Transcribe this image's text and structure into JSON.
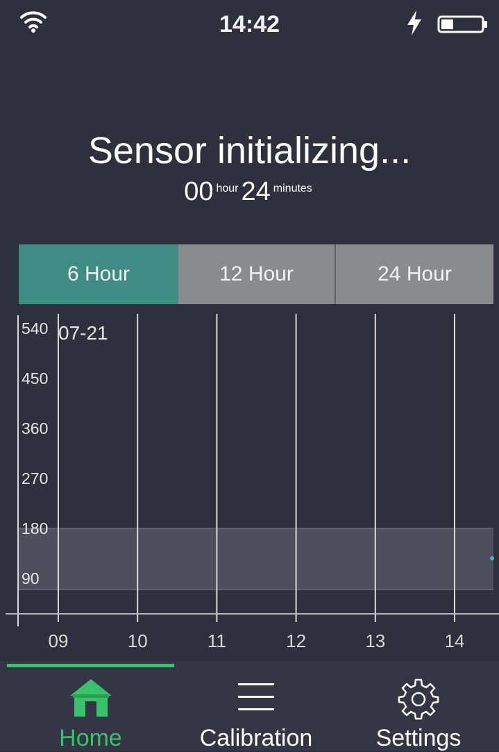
{
  "status_bar": {
    "time": "14:42",
    "wifi_icon": "wifi-icon",
    "charging_icon": "lightning-bolt-icon",
    "battery_icon": "battery-icon",
    "battery_level": 0.3
  },
  "header": {
    "title": "Sensor initializing...",
    "hours_value": "00",
    "hours_unit": "hour",
    "minutes_value": "24",
    "minutes_unit": "minutes"
  },
  "range_tabs": [
    {
      "label": "6 Hour",
      "active": true
    },
    {
      "label": "12 Hour",
      "active": false
    },
    {
      "label": "24 Hour",
      "active": false
    }
  ],
  "chart_data": {
    "type": "line",
    "date_label": "07-21",
    "y_ticks": [
      540,
      450,
      360,
      270,
      180,
      90
    ],
    "x_ticks": [
      "09",
      "10",
      "11",
      "12",
      "13",
      "14"
    ],
    "target_range": [
      70,
      180
    ],
    "ylim": [
      0,
      540
    ],
    "grid": "vertical lines at each hour",
    "series": [
      {
        "values": []
      }
    ],
    "colors": {
      "band": "#4d4f5c",
      "grid": "#d9d9d9",
      "point": "#3fbfc7"
    }
  },
  "nav": {
    "items": [
      {
        "label": "Home",
        "icon": "home-icon",
        "active": true
      },
      {
        "label": "Calibration",
        "icon": "menu-icon",
        "active": false
      },
      {
        "label": "Settings",
        "icon": "gear-icon",
        "active": false
      }
    ],
    "accent": "#36c36a"
  }
}
